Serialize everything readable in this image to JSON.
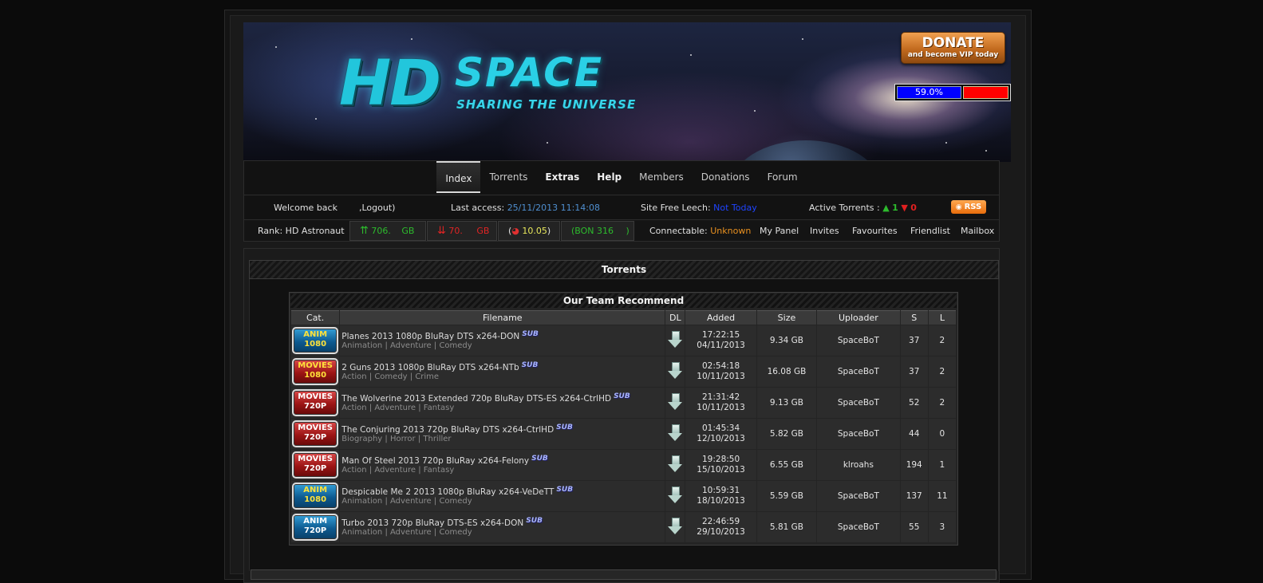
{
  "banner": {
    "logo_hd": "HD",
    "logo_space": "SPACE",
    "tagline": "SHARING THE UNIVERSE",
    "donate_big": "DONATE",
    "donate_small": "and become VIP today",
    "ratio_percent_text": "59.0%",
    "ratio_fraction": 0.59
  },
  "nav": {
    "tabs": [
      {
        "label": "Index",
        "active": true
      },
      {
        "label": "Torrents"
      },
      {
        "label": "Extras"
      },
      {
        "label": "Help"
      },
      {
        "label": "Members"
      },
      {
        "label": "Donations"
      },
      {
        "label": "Forum"
      }
    ]
  },
  "info": {
    "welcome": "Welcome back",
    "logout": ",Logout)",
    "last_access_label": "Last access:",
    "last_access_value": "25/11/2013 11:14:08",
    "free_leech_label": "Site Free Leech:",
    "free_leech_value": "Not Today",
    "active_torrents_label": "Active Torrents :",
    "active_up": "1",
    "active_down": "0",
    "rss": "RSS",
    "rank": "Rank: HD Astronaut",
    "uploaded": "706.",
    "uploaded_unit": "GB",
    "downloaded": "70.",
    "downloaded_unit": "GB",
    "ratio": "10.05",
    "bonus": "(BON 316",
    "bonus_end": ")",
    "connectable_label": "Connectable:",
    "connectable_value": "Unknown",
    "links": [
      "My Panel",
      "Invites",
      "Favourites",
      "Friendlist",
      "Mailbox"
    ]
  },
  "main": {
    "title": "Torrents",
    "recommend_title": "Our Team Recommend",
    "columns": [
      "Cat.",
      "Filename",
      "DL",
      "Added",
      "Size",
      "Uploader",
      "S",
      "L"
    ],
    "rows": [
      {
        "cat1": "ANIM",
        "cat2": "1080",
        "cat_type": "anim",
        "name": "Planes 2013 1080p BluRay DTS x264-DON",
        "sub": "SUB",
        "genres": "Animation | Adventure | Comedy",
        "time": "17:22:15",
        "date": "04/11/2013",
        "size": "9.34 GB",
        "uploader": "SpaceBoT",
        "s": "37",
        "l": "2"
      },
      {
        "cat1": "MOVIES",
        "cat2": "1080",
        "cat_type": "movies",
        "name": "2 Guns 2013 1080p BluRay DTS x264-NTb",
        "sub": "SUB",
        "genres": "Action | Comedy | Crime",
        "time": "02:54:18",
        "date": "10/11/2013",
        "size": "16.08 GB",
        "uploader": "SpaceBoT",
        "s": "37",
        "l": "2"
      },
      {
        "cat1": "MOVIES",
        "cat2": "720P",
        "cat_type": "movies",
        "name": "The Wolverine 2013 Extended 720p BluRay DTS-ES x264-CtrlHD",
        "sub": "SUB",
        "genres": "Action | Adventure | Fantasy",
        "time": "21:31:42",
        "date": "10/11/2013",
        "size": "9.13 GB",
        "uploader": "SpaceBoT",
        "s": "52",
        "l": "2"
      },
      {
        "cat1": "MOVIES",
        "cat2": "720P",
        "cat_type": "movies",
        "name": "The Conjuring 2013 720p BluRay DTS x264-CtrlHD",
        "sub": "SUB",
        "genres": "Biography | Horror | Thriller",
        "time": "01:45:34",
        "date": "12/10/2013",
        "size": "5.82 GB",
        "uploader": "SpaceBoT",
        "s": "44",
        "l": "0"
      },
      {
        "cat1": "MOVIES",
        "cat2": "720P",
        "cat_type": "movies",
        "name": "Man Of Steel 2013 720p BluRay x264-Felony",
        "sub": "SUB",
        "genres": "Action | Adventure | Fantasy",
        "time": "19:28:50",
        "date": "15/10/2013",
        "size": "6.55 GB",
        "uploader": "klroahs",
        "s": "194",
        "l": "1"
      },
      {
        "cat1": "ANIM",
        "cat2": "1080",
        "cat_type": "anim",
        "name": "Despicable Me 2 2013 1080p BluRay x264-VeDeTT",
        "sub": "SUB",
        "genres": "Animation | Adventure | Comedy",
        "time": "10:59:31",
        "date": "18/10/2013",
        "size": "5.59 GB",
        "uploader": "SpaceBoT",
        "s": "137",
        "l": "11"
      },
      {
        "cat1": "ANIM",
        "cat2": "720P",
        "cat_type": "anim",
        "name": "Turbo 2013 720p BluRay DTS-ES x264-DON",
        "sub": "SUB",
        "genres": "Animation | Adventure | Comedy",
        "time": "22:46:59",
        "date": "29/10/2013",
        "size": "5.81 GB",
        "uploader": "SpaceBoT",
        "s": "55",
        "l": "3"
      }
    ]
  },
  "colors": {
    "background": "#0b0b0b",
    "panel": "#1b1b1b",
    "cyan_logo": "#22c6dc",
    "ratio_blue": "#0000ff",
    "ratio_red": "#ff0000",
    "up_green": "#2dbb2d",
    "down_red": "#e02020",
    "rss_orange": "#e86d0c"
  },
  "icons": [
    "donate-button-graphic",
    "rss-feed-icon",
    "upload-arrows-icon",
    "download-arrows-icon",
    "ratio-icon",
    "download-arrow-icon",
    "sub-badge-icon",
    "category-badge-icon"
  ]
}
